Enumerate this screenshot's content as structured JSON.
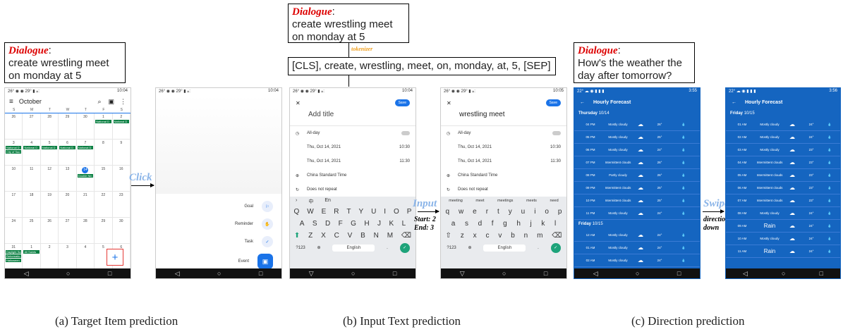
{
  "dialogue_label": "Dialogue",
  "panels": {
    "a": {
      "dialogue": "create wrestling meet on monday at 5",
      "action": "Click",
      "caption": "(a)  Target Item prediction"
    },
    "b": {
      "dialogue": "create wrestling meet on monday at 5",
      "tokenizer": "tokenizer",
      "tokens": "[CLS], create, wrestling, meet, on, monday, at, 5, [SEP]",
      "action": "Input",
      "action_detail1": "Start: 2",
      "action_detail2": "End: 3",
      "caption": "(b)  Input Text prediction"
    },
    "c": {
      "dialogue": "How's the weather the day after tomorrow?",
      "action": "Swipe",
      "action_detail1": "direction:",
      "action_detail2": "down",
      "caption": "(c)  Direction prediction"
    }
  },
  "calendar": {
    "status_time": "10:04",
    "month": "October",
    "weekdays": [
      "S",
      "M",
      "T",
      "W",
      "T",
      "F",
      "S"
    ],
    "days": [
      "26",
      "27",
      "28",
      "29",
      "30",
      "1",
      "2",
      "3",
      "4",
      "5",
      "6",
      "7",
      "8",
      "9",
      "10",
      "11",
      "12",
      "13",
      "14",
      "15",
      "16",
      "17",
      "18",
      "19",
      "20",
      "21",
      "22",
      "23",
      "24",
      "25",
      "26",
      "27",
      "28",
      "29",
      "30",
      "31",
      "1",
      "2",
      "3",
      "4",
      "5",
      "6"
    ],
    "chip_national": "National D",
    "chip_double": "Double Nin",
    "chip_daylight": "Daylight Sa",
    "chip_allsaints": "All Saints",
    "chip_reformation": "Reformatio",
    "chip_halloween": "Halloween",
    "chip_city": "City of Sao"
  },
  "menu": {
    "status_time": "10:04",
    "month": "October",
    "items": [
      "Goal",
      "Reminder",
      "Task",
      "Event"
    ]
  },
  "form1": {
    "status_time": "10:04",
    "title_placeholder": "Add title",
    "save": "Save",
    "allday": "All-day",
    "date1": "Thu, Oct 14, 2021",
    "time1": "10:30",
    "date2": "Thu, Oct 14, 2021",
    "time2": "11:30",
    "tz": "China Standard Time",
    "repeat": "Does not repeat",
    "kb_lang1": "中",
    "kb_lang2": "En"
  },
  "form2": {
    "status_time": "10:05",
    "title_value": "wrestling meet",
    "save": "Save",
    "allday": "All-day",
    "date1": "Thu, Oct 14, 2021",
    "time1": "10:30",
    "date2": "Thu, Oct 14, 2021",
    "time2": "11:30",
    "tz": "China Standard Time",
    "repeat": "Does not repeat",
    "suggestions": [
      "meeting",
      "meet",
      "meetings",
      "meets",
      "need"
    ]
  },
  "keyboard": {
    "row1_upper": [
      "Q",
      "W",
      "E",
      "R",
      "T",
      "Y",
      "U",
      "I",
      "O",
      "P"
    ],
    "row2_upper": [
      "A",
      "S",
      "D",
      "F",
      "G",
      "H",
      "J",
      "K",
      "L"
    ],
    "row3_upper": [
      "Z",
      "X",
      "C",
      "V",
      "B",
      "N",
      "M"
    ],
    "row1_lower": [
      "q",
      "w",
      "e",
      "r",
      "t",
      "y",
      "u",
      "i",
      "o",
      "p"
    ],
    "row2_lower": [
      "a",
      "s",
      "d",
      "f",
      "g",
      "h",
      "j",
      "k",
      "l"
    ],
    "row3_lower": [
      "z",
      "x",
      "c",
      "v",
      "b",
      "n",
      "m"
    ],
    "sym": "?123",
    "space": "English"
  },
  "weather1": {
    "status_time": "3:55",
    "title": "Hourly Forecast",
    "day1": "Thursday",
    "day1_date": "10/14",
    "day2": "Friday",
    "day2_date": "10/15",
    "rows1": [
      [
        "04 PM",
        "Mostly cloudy",
        "26°"
      ],
      [
        "05 PM",
        "Mostly cloudy",
        "25°"
      ],
      [
        "06 PM",
        "Mostly cloudy",
        "24°"
      ],
      [
        "07 PM",
        "Intermittent clouds",
        "26°"
      ],
      [
        "08 PM",
        "Partly cloudy",
        "26°"
      ],
      [
        "09 PM",
        "Intermittent clouds",
        "25°"
      ],
      [
        "10 PM",
        "Intermittent clouds",
        "25°"
      ],
      [
        "11 PM",
        "Mostly cloudy",
        "24°"
      ]
    ],
    "rows2": [
      [
        "12 AM",
        "Mostly cloudy",
        "24°"
      ],
      [
        "01 AM",
        "Mostly cloudy",
        "24°"
      ],
      [
        "02 AM",
        "Mostly cloudy",
        "24°"
      ]
    ]
  },
  "weather2": {
    "status_time": "3:56",
    "title": "Hourly Forecast",
    "day": "Friday",
    "day_date": "10/15",
    "rows": [
      [
        "01 AM",
        "Mostly cloudy",
        "24°"
      ],
      [
        "02 AM",
        "Mostly cloudy",
        "24°"
      ],
      [
        "03 AM",
        "Mostly cloudy",
        "23°"
      ],
      [
        "04 AM",
        "Intermittent clouds",
        "23°"
      ],
      [
        "05 AM",
        "Intermittent clouds",
        "23°"
      ],
      [
        "06 AM",
        "Intermittent clouds",
        "23°"
      ],
      [
        "07 AM",
        "Intermittent clouds",
        "23°"
      ],
      [
        "08 AM",
        "Mostly cloudy",
        "24°"
      ],
      [
        "09 AM",
        "Rain",
        "24°"
      ],
      [
        "10 AM",
        "Mostly cloudy",
        "24°"
      ],
      [
        "11 AM",
        "Rain",
        "24°"
      ]
    ]
  }
}
